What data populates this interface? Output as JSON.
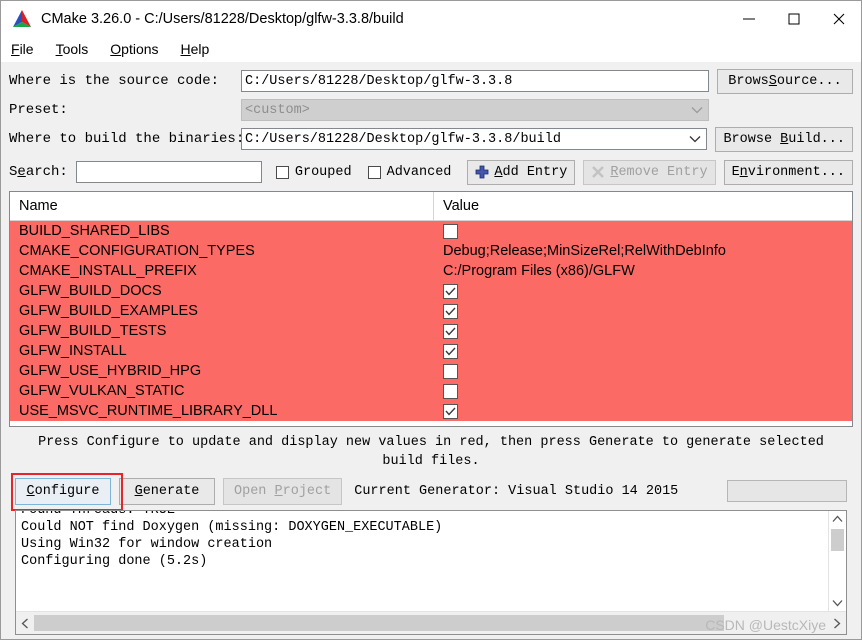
{
  "window": {
    "title": "CMake 3.26.0 - C:/Users/81228/Desktop/glfw-3.3.8/build",
    "app_icon": "cmake-logo-icon",
    "minimize_label": "—",
    "maximize_label": "□",
    "close_label": "✕"
  },
  "menu": {
    "items": [
      {
        "label": "File",
        "mnemonic": "F",
        "rest": "ile"
      },
      {
        "label": "Tools",
        "mnemonic": "T",
        "rest": "ools"
      },
      {
        "label": "Options",
        "mnemonic": "O",
        "rest": "ptions"
      },
      {
        "label": "Help",
        "mnemonic": "H",
        "rest": "elp"
      }
    ]
  },
  "form": {
    "source_label": "Where is the source code:",
    "source_value": "C:/Users/81228/Desktop/glfw-3.3.8",
    "browse_source_label": "Browse Source...",
    "browse_source_mnemonic": "S",
    "preset_label": "Preset:",
    "preset_value": "<custom>",
    "binaries_label": "Where to build the binaries:",
    "binaries_value": "C:/Users/81228/Desktop/glfw-3.3.8/build",
    "browse_build_label": "Browse Build...",
    "browse_build_mnemonic": "B"
  },
  "search": {
    "label": "Search:",
    "label_mnemonic": "e",
    "value": "",
    "placeholder": "",
    "grouped_label": "Grouped",
    "grouped_checked": false,
    "advanced_label": "Advanced",
    "advanced_checked": false,
    "add_entry_label": "Add Entry",
    "add_entry_mnemonic": "A",
    "add_entry_icon": "plus-icon",
    "remove_entry_label": "Remove Entry",
    "remove_entry_mnemonic": "R",
    "remove_entry_icon": "remove-x-icon",
    "remove_entry_disabled": true,
    "environment_label": "Environment...",
    "environment_mnemonic": "n"
  },
  "cache_table": {
    "headers": [
      "Name",
      "Value"
    ],
    "row_highlight_color": "#fb6a64",
    "rows": [
      {
        "name": "BUILD_SHARED_LIBS",
        "type": "checkbox",
        "checked": false,
        "value": ""
      },
      {
        "name": "CMAKE_CONFIGURATION_TYPES",
        "type": "text",
        "checked": false,
        "value": "Debug;Release;MinSizeRel;RelWithDebInfo"
      },
      {
        "name": "CMAKE_INSTALL_PREFIX",
        "type": "text",
        "checked": false,
        "value": "C:/Program Files (x86)/GLFW"
      },
      {
        "name": "GLFW_BUILD_DOCS",
        "type": "checkbox",
        "checked": true,
        "value": ""
      },
      {
        "name": "GLFW_BUILD_EXAMPLES",
        "type": "checkbox",
        "checked": true,
        "value": ""
      },
      {
        "name": "GLFW_BUILD_TESTS",
        "type": "checkbox",
        "checked": true,
        "value": ""
      },
      {
        "name": "GLFW_INSTALL",
        "type": "checkbox",
        "checked": true,
        "value": ""
      },
      {
        "name": "GLFW_USE_HYBRID_HPG",
        "type": "checkbox",
        "checked": false,
        "value": ""
      },
      {
        "name": "GLFW_VULKAN_STATIC",
        "type": "checkbox",
        "checked": false,
        "value": ""
      },
      {
        "name": "USE_MSVC_RUNTIME_LIBRARY_DLL",
        "type": "checkbox",
        "checked": true,
        "value": ""
      }
    ]
  },
  "status": {
    "message": "Press Configure to update and display new values in red, then press Generate to generate selected build files."
  },
  "actions": {
    "configure_label": "Configure",
    "configure_mnemonic": "C",
    "configure_highlighted": true,
    "generate_label": "Generate",
    "generate_mnemonic": "G",
    "open_project_label": "Open Project",
    "open_project_mnemonic": "P",
    "open_project_disabled": true,
    "current_generator": "Current Generator: Visual Studio 14 2015",
    "progress_value": 0
  },
  "log": {
    "lines": [
      "Found Threads: TRUE",
      "Could NOT find Doxygen (missing: DOXYGEN_EXECUTABLE)",
      "Using Win32 for window creation",
      "Configuring done (5.2s)"
    ]
  },
  "watermark": {
    "text": "CSDN @UestcXiye"
  }
}
